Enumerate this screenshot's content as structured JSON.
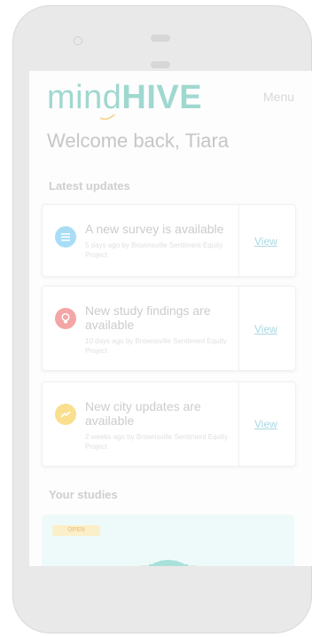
{
  "app": {
    "logo_light": "mind",
    "logo_bold": "HIVE",
    "menu_label": "Menu"
  },
  "header": {
    "welcome": "Welcome back, Tiara"
  },
  "updates": {
    "title": "Latest updates",
    "items": [
      {
        "icon": "list-icon",
        "title": "A new survey is available",
        "meta": "5 days ago by Brownsville Sentiment Equity Project",
        "action": "View",
        "color": "#a9ddf6"
      },
      {
        "icon": "lightbulb-icon",
        "title": "New study findings are available",
        "meta": "10 days ago by Brownsville Sentiment Equity Project",
        "action": "View",
        "color": "#f4a6a6"
      },
      {
        "icon": "trend-icon",
        "title": "New city updates are available",
        "meta": "2 weeks ago by Brownsville Sentiment Equity Project",
        "action": "View",
        "color": "#f9df8e"
      }
    ]
  },
  "studies": {
    "title": "Your studies",
    "badge": "OPEN"
  }
}
